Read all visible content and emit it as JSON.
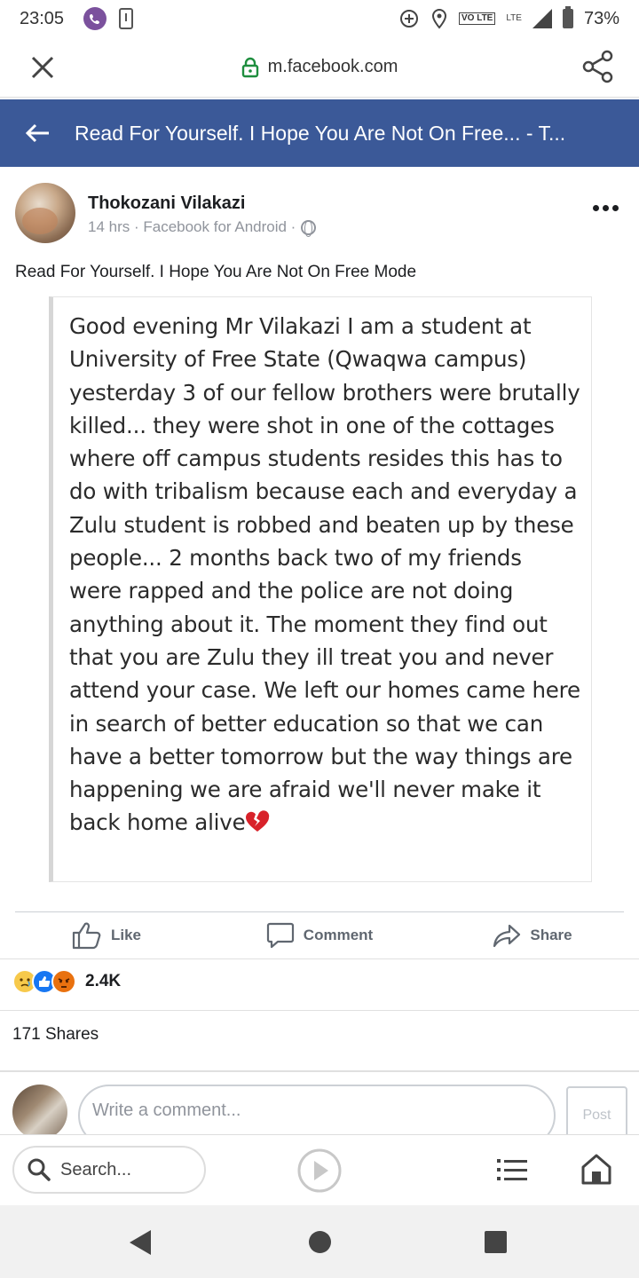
{
  "status_bar": {
    "time": "23:05",
    "battery": "73%",
    "volte": "VO LTE",
    "lte": "LTE"
  },
  "browser": {
    "url": "m.facebook.com"
  },
  "header": {
    "title": "Read For Yourself. I Hope You Are Not On Free... - T..."
  },
  "post": {
    "author": "Thokozani Vilakazi",
    "meta": "14 hrs · Facebook for Android ·",
    "text": "Read For Yourself. I Hope You Are Not On Free Mode",
    "image_text": "Good evening Mr Vilakazi I am a student at University of Free State (Qwaqwa campus) yesterday 3 of our fellow brothers were brutally killed... they were shot in one of the cottages where off campus students resides this has to do with tribalism because each and everyday a Zulu student is robbed and beaten up by these people... 2 months back two of my friends were rapped and the police are not doing anything about it. The moment they find out that you are Zulu they ill treat you and never attend your case. We left our homes came here in search of better education so that we can have a better tomorrow but the way things are happening we are afraid we'll never make it back home alive"
  },
  "actions": {
    "like": "Like",
    "comment": "Comment",
    "share": "Share"
  },
  "stats": {
    "reactions": "2.4K",
    "shares": "171 Shares"
  },
  "comment_box": {
    "placeholder": "Write a comment...",
    "post_label": "Post"
  },
  "bottom_bar": {
    "search_placeholder": "Search..."
  },
  "colors": {
    "facebook_blue": "#3b5998",
    "like_blue": "#1877f2",
    "angry_orange": "#e9710f",
    "sad_yellow": "#f7c94b",
    "viber_purple": "#7b519d",
    "lock_green": "#1e8e3e"
  },
  "icons": [
    "viber-icon",
    "sim-icon",
    "add-circle-icon",
    "location-icon",
    "signal-icon",
    "battery-icon",
    "close-icon",
    "lock-icon",
    "share-icon",
    "back-arrow-icon",
    "globe-icon",
    "more-icon",
    "broken-heart-icon",
    "like-icon",
    "comment-icon",
    "share-arrow-icon",
    "sad-reaction-icon",
    "like-reaction-icon",
    "angry-reaction-icon",
    "search-icon",
    "play-icon",
    "list-icon",
    "home-icon"
  ]
}
